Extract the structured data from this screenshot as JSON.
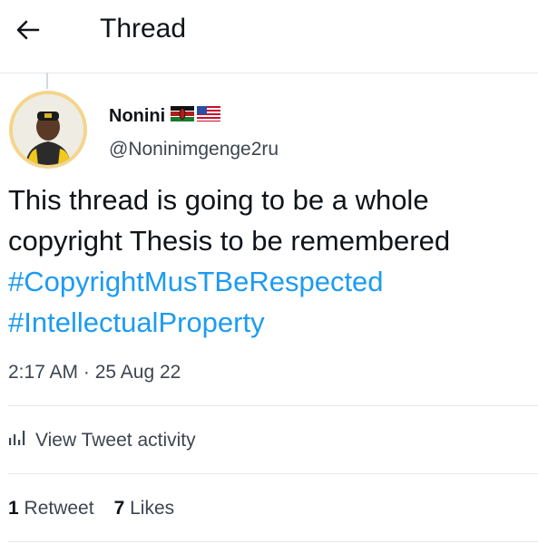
{
  "header": {
    "title": "Thread"
  },
  "tweet": {
    "author_name": "Nonini",
    "handle": "@Noninimgenge2ru",
    "text_lines": [
      "This thread is going to be a whole",
      "copyright Thesis to be remembered"
    ],
    "hashtags": [
      "#CopyrightMusTBeRespected",
      "#IntellectualProperty"
    ],
    "time": "2:17 AM",
    "separator": "·",
    "date": "25 Aug 22",
    "activity_label": "View Tweet activity",
    "retweets_count": "1",
    "retweets_label": "Retweet",
    "likes_count": "7",
    "likes_label": "Likes"
  },
  "icons": {
    "back": "arrow-left-icon",
    "flag1": "kenya-flag-icon",
    "flag2": "us-flag-icon",
    "activity": "bar-chart-icon"
  },
  "colors": {
    "hashtag": "#1d9bf0",
    "text": "#0f1419",
    "secondary": "#3d4650",
    "divider": "#e6e8eb"
  }
}
